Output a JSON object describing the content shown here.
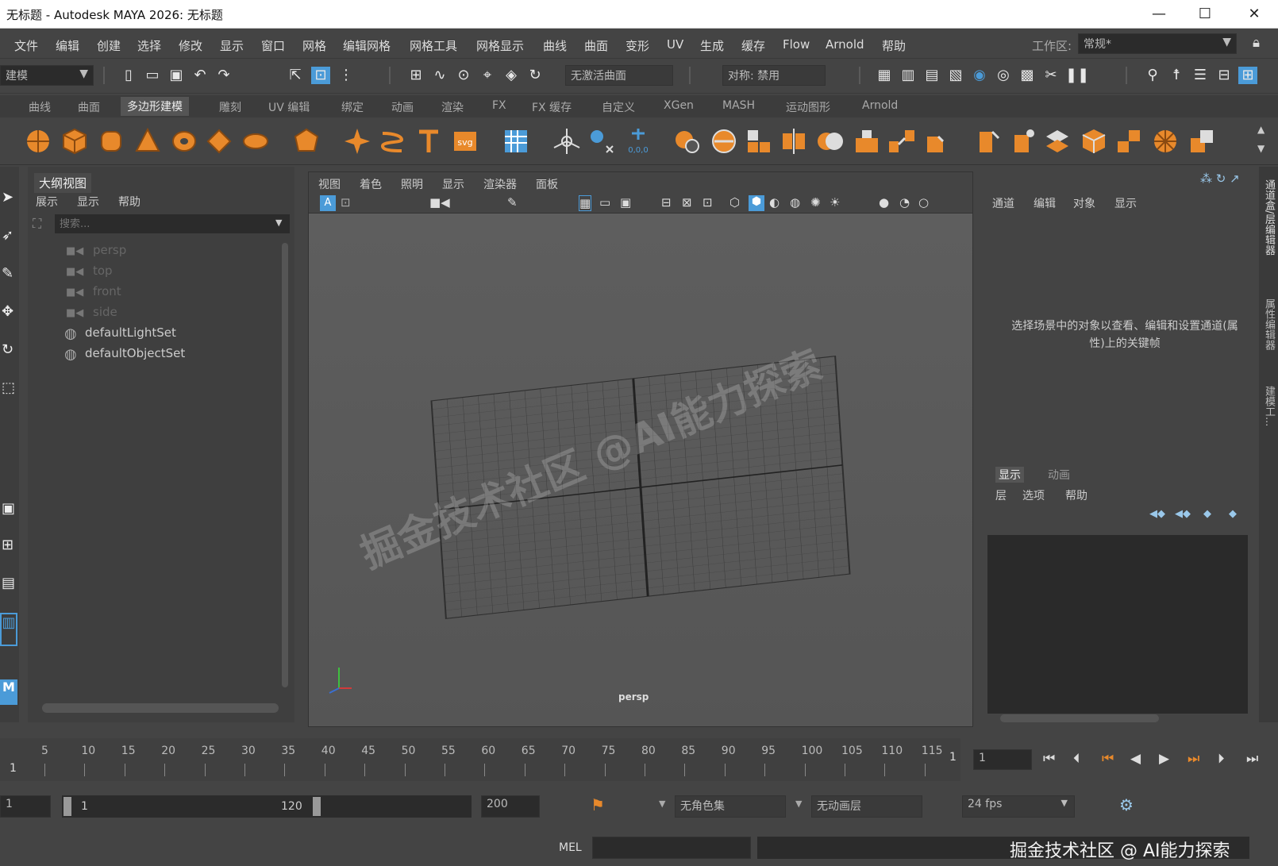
{
  "window": {
    "title": "无标题 - Autodesk MAYA 2026: 无标题",
    "min": "—",
    "max": "☐",
    "close": "✕"
  },
  "menus": [
    "文件",
    "编辑",
    "创建",
    "选择",
    "修改",
    "显示",
    "窗口",
    "网格",
    "编辑网格",
    "网格工具",
    "网格显示",
    "曲线",
    "曲面",
    "变形",
    "UV",
    "生成",
    "缓存",
    "Flow",
    "Arnold",
    "帮助"
  ],
  "workspace": {
    "label": "工作区:",
    "value": "常规*"
  },
  "toolbar": {
    "mode": "建模",
    "live_surface": "无激活曲面",
    "symmetry": "对称: 禁用"
  },
  "shelf_tabs": [
    "曲线",
    "曲面",
    "多边形建模",
    "雕刻",
    "UV 编辑",
    "绑定",
    "动画",
    "渲染",
    "FX",
    "FX 缓存",
    "自定义",
    "XGen",
    "MASH",
    "运动图形",
    "Arnold"
  ],
  "active_shelf": "多边形建模",
  "outliner": {
    "title": "大纲视图",
    "menus": [
      "展示",
      "显示",
      "帮助"
    ],
    "search_placeholder": "搜索...",
    "items": [
      {
        "label": "persp",
        "type": "camera"
      },
      {
        "label": "top",
        "type": "camera"
      },
      {
        "label": "front",
        "type": "camera"
      },
      {
        "label": "side",
        "type": "camera"
      },
      {
        "label": "defaultLightSet",
        "type": "set"
      },
      {
        "label": "defaultObjectSet",
        "type": "set"
      }
    ]
  },
  "viewport": {
    "menus": [
      "视图",
      "着色",
      "照明",
      "显示",
      "渲染器",
      "面板"
    ],
    "camera_label": "persp"
  },
  "channel_box": {
    "menus": [
      "通道",
      "编辑",
      "对象",
      "显示"
    ],
    "message": "选择场景中的对象以查看、编辑和设置通道(属性)上的关键帧"
  },
  "layer_editor": {
    "tabs": [
      "显示",
      "动画"
    ],
    "menus": [
      "层",
      "选项",
      "帮助"
    ]
  },
  "side_tabs": [
    "通道盒/层编辑器",
    "属性编辑器",
    "建模工..."
  ],
  "timeline": {
    "ticks": [
      "5",
      "10",
      "15",
      "20",
      "25",
      "30",
      "35",
      "40",
      "45",
      "50",
      "55",
      "60",
      "65",
      "70",
      "75",
      "80",
      "85",
      "90",
      "95",
      "100",
      "105",
      "110",
      "115"
    ],
    "start_marker": "1",
    "end_marker": "1",
    "current_frame": "1"
  },
  "range": {
    "anim_start": "1",
    "play_start": "1",
    "play_end": "120",
    "anim_end": "200",
    "character_set": "无角色集",
    "anim_layer": "无动画层",
    "fps": "24 fps"
  },
  "command_line": {
    "label": "MEL"
  },
  "watermarks": {
    "diagonal": "掘金技术社区 @AI能力探索",
    "corner": "掘金技术社区 @ AI能力探索"
  },
  "colors": {
    "accent_orange": "#e8892b",
    "accent_blue": "#4b9bd8",
    "panel_bg": "#444444"
  }
}
